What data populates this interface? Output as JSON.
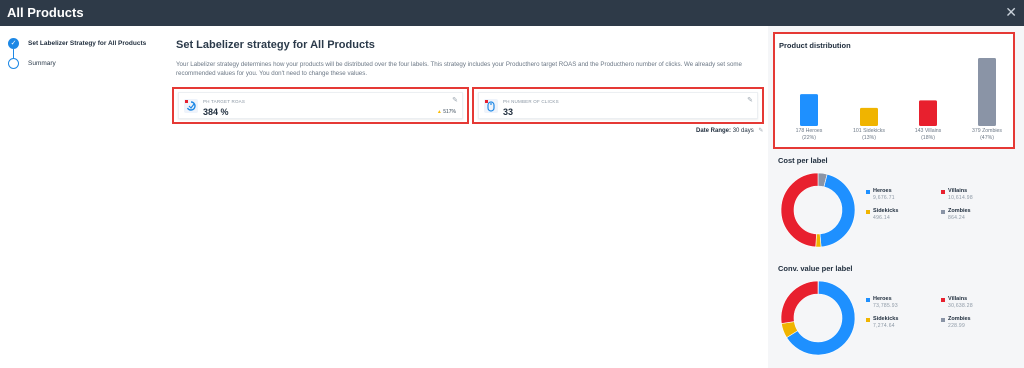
{
  "window": {
    "title": "All Products"
  },
  "steps": [
    {
      "label": "Set Labelizer Strategy for All Products",
      "state": "done"
    },
    {
      "label": "Summary",
      "state": "todo"
    }
  ],
  "main": {
    "heading": "Set Labelizer strategy for All Products",
    "description": "Your Labelizer strategy determines how your products will be distributed over the four labels. This strategy includes your Producthero target ROAS and the Producthero number of clicks. We already set some recommended values for you. You don't need to change these values.",
    "cards": [
      {
        "label": "PH TARGET ROAS",
        "value": "384 %",
        "badge": "517%"
      },
      {
        "label": "PH NUMBER OF CLICKS",
        "value": "33"
      }
    ],
    "date_range": {
      "label": "Date Range:",
      "value": "30 days"
    }
  },
  "colors": {
    "heroes": "#1e90ff",
    "sidekicks": "#f0b400",
    "villains": "#e8202e",
    "zombies": "#8a94a6",
    "accent": "#1e88e5"
  },
  "product_distribution": {
    "title": "Product distribution",
    "chart_data": {
      "type": "bar",
      "categories": [
        "Heroes",
        "Sidekicks",
        "Villains",
        "Zombies"
      ],
      "values": [
        178,
        101,
        143,
        379
      ],
      "labels": [
        "178 Heroes",
        "101 Sidekicks",
        "143 Villains",
        "379 Zombies"
      ],
      "percents": [
        "(22%)",
        "(13%)",
        "(18%)",
        "(47%)"
      ]
    }
  },
  "cost_per_label": {
    "title": "Cost per label",
    "chart_data": {
      "type": "pie",
      "categories": [
        "Heroes",
        "Villains",
        "Sidekicks",
        "Zombies"
      ],
      "values": [
        9676.71,
        10614.98,
        496.14,
        864.24
      ],
      "display": [
        "9,676.71",
        "10,614.98",
        "496.14",
        "864.24"
      ]
    }
  },
  "conv_value_per_label": {
    "title": "Conv. value per label",
    "chart_data": {
      "type": "pie",
      "categories": [
        "Heroes",
        "Villains",
        "Sidekicks",
        "Zombies"
      ],
      "values": [
        73785.93,
        30638.28,
        7274.64,
        228.99
      ],
      "display": [
        "73,785.93",
        "30,638.28",
        "7,274.64",
        "228.99"
      ]
    }
  }
}
